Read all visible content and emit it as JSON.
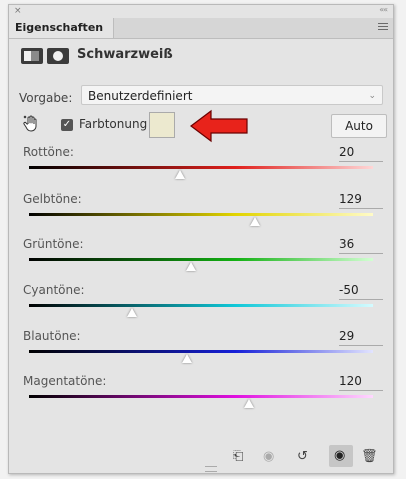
{
  "panel": {
    "close_glyph": "×",
    "collapse_glyph": "««",
    "tab_title": "Eigenschaften",
    "adjustment_title": "Schwarzweiß",
    "preset_label": "Vorgabe:",
    "preset_value": "Benutzerdefiniert",
    "tint_label": "Farbtonung",
    "tint_checked": true,
    "tint_color": "#ece9cf",
    "auto_label": "Auto",
    "annotation_color": "#e8231b"
  },
  "sliders": [
    {
      "label": "Rottöne:",
      "value": "20",
      "min": -200,
      "max": 300,
      "gradient": [
        "#000000",
        "#e0201c",
        "#ffd6d6"
      ]
    },
    {
      "label": "Gelbtöne:",
      "value": "129",
      "min": -200,
      "max": 300,
      "gradient": [
        "#000000",
        "#e2d400",
        "#fffbc8"
      ]
    },
    {
      "label": "Grüntöne:",
      "value": "36",
      "min": -200,
      "max": 300,
      "gradient": [
        "#000000",
        "#13b013",
        "#d2ffd2"
      ]
    },
    {
      "label": "Cyantöne:",
      "value": "-50",
      "min": -200,
      "max": 300,
      "gradient": [
        "#000000",
        "#10c8d8",
        "#d4fbff"
      ]
    },
    {
      "label": "Blautöne:",
      "value": "29",
      "min": -200,
      "max": 300,
      "gradient": [
        "#000000",
        "#1620d8",
        "#e2e4ff"
      ]
    },
    {
      "label": "Magentatöne:",
      "value": "120",
      "min": -200,
      "max": 300,
      "gradient": [
        "#000000",
        "#e010e0",
        "#ffd8ff"
      ]
    }
  ],
  "toolbar_icons": [
    "clip-to-layer-icon",
    "view-previous-icon",
    "reset-icon",
    "visibility-eye-icon",
    "trash-icon"
  ]
}
